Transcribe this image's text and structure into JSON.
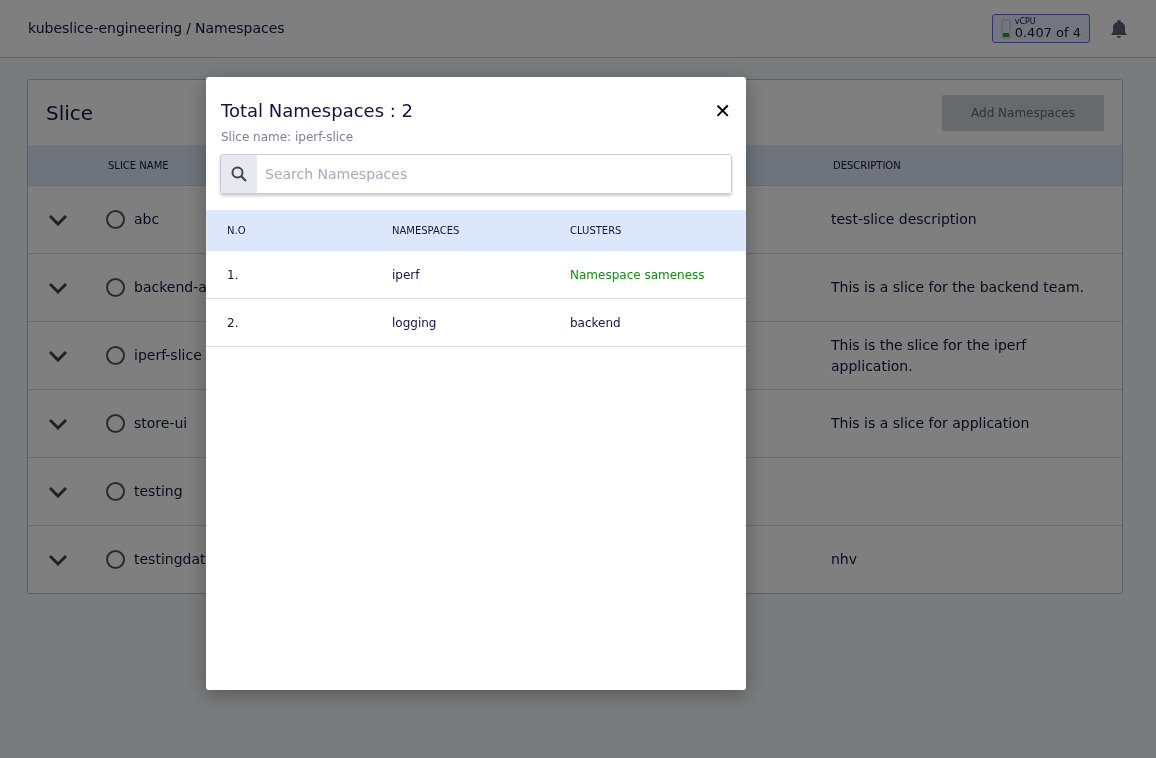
{
  "header": {
    "breadcrumb": [
      {
        "label": "kubeslice-engineering"
      },
      {
        "label": "/"
      },
      {
        "label": "Namespaces"
      }
    ],
    "vcpu": {
      "label": "vCPU",
      "value": "0.407",
      "of": "of 4"
    }
  },
  "slice_card": {
    "title": "Slice",
    "add_button": {
      "label": "Add Namespaces",
      "disabled": true
    },
    "columns": [
      "SLICE NAME",
      "DESCRIPTION"
    ],
    "rows": [
      {
        "name": "abc",
        "description": "test-slice description",
        "selected": false,
        "expanded": false
      },
      {
        "name": "backend-a",
        "description": "This is a slice for the backend team.",
        "selected": false,
        "expanded": false
      },
      {
        "name": "iperf-slice",
        "description": "This is the slice for the iperf application.",
        "selected": false,
        "expanded": false
      },
      {
        "name": "store-ui",
        "description": "This is a slice for application",
        "selected": false,
        "expanded": false
      },
      {
        "name": "testing",
        "selected": false,
        "expanded": false
      },
      {
        "name": "testingdat",
        "description": "nhv",
        "selected": false,
        "expanded": false
      }
    ]
  },
  "modal": {
    "title": "Total Namespaces : 2",
    "subtitle": "Slice name: iperf-slice",
    "close": "✕",
    "search": {
      "placeholder": "Search Namespaces"
    },
    "columns": [
      "N.O",
      "NAMESPACES",
      "CLUSTERS"
    ],
    "rows": [
      {
        "no": "1.",
        "namespace": "iperf",
        "cluster": "Namespace sameness",
        "kind": "sameness"
      },
      {
        "no": "2.",
        "namespace": "logging",
        "cluster": "backend",
        "kind": "cluster"
      }
    ]
  }
}
